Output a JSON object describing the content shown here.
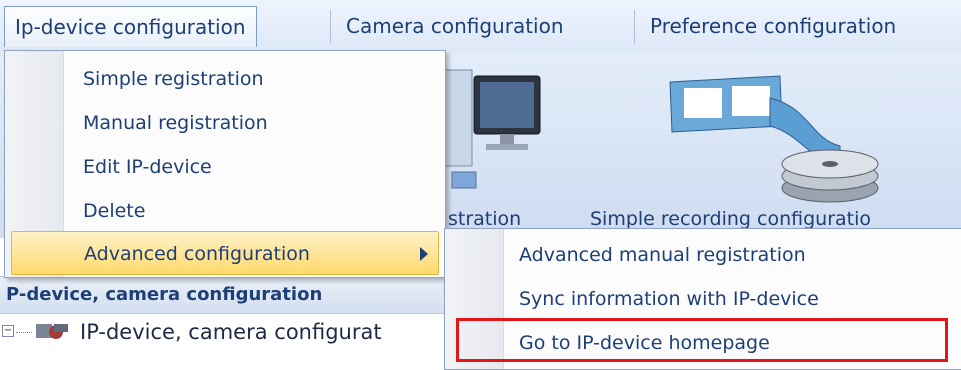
{
  "menubar": {
    "items": [
      {
        "label": "Ip-device configuration"
      },
      {
        "label": "Camera configuration"
      },
      {
        "label": "Preference configuration"
      }
    ]
  },
  "ribbon": {
    "labels": [
      "stration",
      "Simple recording configuratio"
    ]
  },
  "dropdown": {
    "items": [
      {
        "label": "Simple registration"
      },
      {
        "label": "Manual registration"
      },
      {
        "label": "Edit IP-device"
      },
      {
        "label": "Delete"
      },
      {
        "label": "Advanced configuration"
      }
    ]
  },
  "submenu": {
    "items": [
      {
        "label": "Advanced manual registration"
      },
      {
        "label": "Sync information with IP-device"
      },
      {
        "label": "Go to IP-device homepage"
      }
    ]
  },
  "tree": {
    "header": "P-device, camera configuration",
    "row_label": "IP-device, camera configurat"
  },
  "colors": {
    "highlight": "#ffd96b",
    "callout_border": "#e0161b",
    "menu_text": "#1e3f75"
  }
}
